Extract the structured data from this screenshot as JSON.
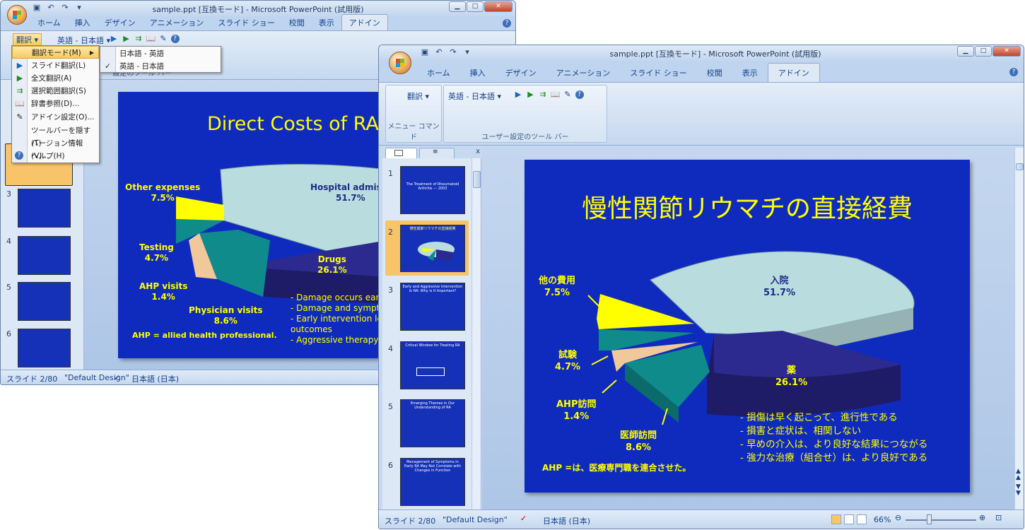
{
  "window_back": {
    "title": "sample.ppt [互換モード] - Microsoft PowerPoint (試用版)",
    "tabs": [
      "ホーム",
      "挿入",
      "デザイン",
      "アニメーション",
      "スライド ショー",
      "校閲",
      "表示",
      "アドイン"
    ],
    "toolbar": {
      "translate_label": "翻訳",
      "language_label": "英語 - 日本語",
      "group_caption": "設定のツール バー"
    },
    "menu": {
      "items": [
        "翻訳モード(M)",
        "スライド翻訳(L)",
        "全文翻訳(A)",
        "選択範囲翻訳(S)",
        "辞書参照(D)...",
        "アドイン設定(O)...",
        "ツールバーを隠す(T)",
        "バージョン情報(V)...",
        "ヘルプ(H)"
      ],
      "submenu": [
        "日本語 - 英語",
        "英語 - 日本語"
      ]
    },
    "slide": {
      "title": "Direct Costs of RA",
      "labels": {
        "other": [
          "Other expenses",
          "7.5%"
        ],
        "hospital": [
          "Hospital admiss",
          "51.7%"
        ],
        "testing": [
          "Testing",
          "4.7%"
        ],
        "drugs": [
          "Drugs",
          "26.1%"
        ],
        "ahp": [
          "AHP visits",
          "1.4%"
        ],
        "physician": [
          "Physician visits",
          "8.6%"
        ]
      },
      "note": "AHP = allied health professional.",
      "bullets": [
        "-  Damage occurs ear",
        "-  Damage and sympt",
        "-  Early intervention le",
        "    outcomes",
        "-  Aggressive therapy"
      ]
    },
    "thumb_numbers": [
      "3",
      "4",
      "5",
      "6"
    ],
    "status": {
      "slide": "スライド 2/80",
      "design": "\"Default Design\"",
      "lang": "日本語 (日本)"
    }
  },
  "window_front": {
    "title": "sample.ppt [互換モード] - Microsoft PowerPoint (試用版)",
    "tabs": [
      "ホーム",
      "挿入",
      "デザイン",
      "アニメーション",
      "スライド ショー",
      "校閲",
      "表示",
      "アドイン"
    ],
    "toolbar": {
      "translate_label": "翻訳",
      "language_label": "英語 - 日本語",
      "group1_caption": "メニュー コマンド",
      "group2_caption": "ユーザー設定のツール バー"
    },
    "slide": {
      "title": "慢性関節リウマチの直接経費",
      "labels": {
        "other": [
          "他の費用",
          "7.5%"
        ],
        "hospital": [
          "入院",
          "51.7%"
        ],
        "testing": [
          "試験",
          "4.7%"
        ],
        "drugs": [
          "薬",
          "26.1%"
        ],
        "ahp": [
          "AHP訪問",
          "1.4%"
        ],
        "physician": [
          "医師訪問",
          "8.6%"
        ]
      },
      "note": "AHP =は、医療専門職を連合させた。",
      "bullets": [
        "-  損傷は早く起こって、進行性である",
        "-  損害と症状は、相関しない",
        "-  早めの介入は、より良好な結果につながる",
        "-  強力な治療（組合せ）は、より良好である"
      ]
    },
    "thumbs": [
      {
        "num": "1",
        "title": "The Treatment  of Rheumatoid Arthritis  — 2003"
      },
      {
        "num": "2",
        "title": "慢性関節リウマチの直接経費"
      },
      {
        "num": "3",
        "title": "Early and Aggressive Intervention in RA: Why is it Important?"
      },
      {
        "num": "4",
        "title": "Critical Window for Treating RA"
      },
      {
        "num": "5",
        "title": "Emerging Themes in Our Understanding of RA"
      },
      {
        "num": "6",
        "title": "Management of Symptoms in Early RA May Not Correlate with Changes in Function"
      }
    ],
    "status": {
      "slide": "スライド 2/80",
      "design": "\"Default Design\"",
      "lang": "日本語 (日本)",
      "zoom": "66%"
    }
  },
  "colors": {
    "slide_bg": "#0f2bbd",
    "accent_yellow": "#ffff00",
    "hospital": "#b9dddf",
    "drugs": "#2c2a8f",
    "teal": "#0f8b8b",
    "other": "#ffff00",
    "ahp": "#f0c89a"
  }
}
